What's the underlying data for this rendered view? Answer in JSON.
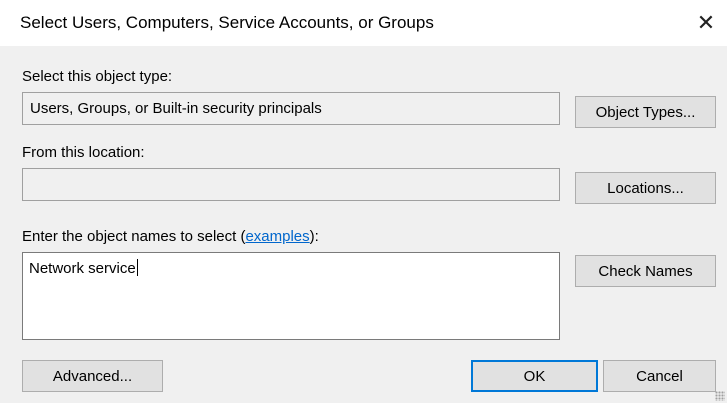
{
  "window": {
    "title": "Select Users, Computers, Service Accounts, or Groups",
    "close_glyph": "✕"
  },
  "object_type": {
    "label": "Select this object type:",
    "value": "Users, Groups, or Built-in security principals",
    "button": "Object Types..."
  },
  "location": {
    "label": "From this location:",
    "value": "",
    "button": "Locations..."
  },
  "names": {
    "label_prefix": "Enter the object names to select (",
    "label_link": "examples",
    "label_suffix": "):",
    "value": "Network service",
    "check_button": "Check Names"
  },
  "footer": {
    "advanced_button": "Advanced...",
    "ok_button": "OK",
    "cancel_button": "Cancel"
  },
  "colors": {
    "link": "#0066cc",
    "default_button_border": "#0078d7"
  }
}
